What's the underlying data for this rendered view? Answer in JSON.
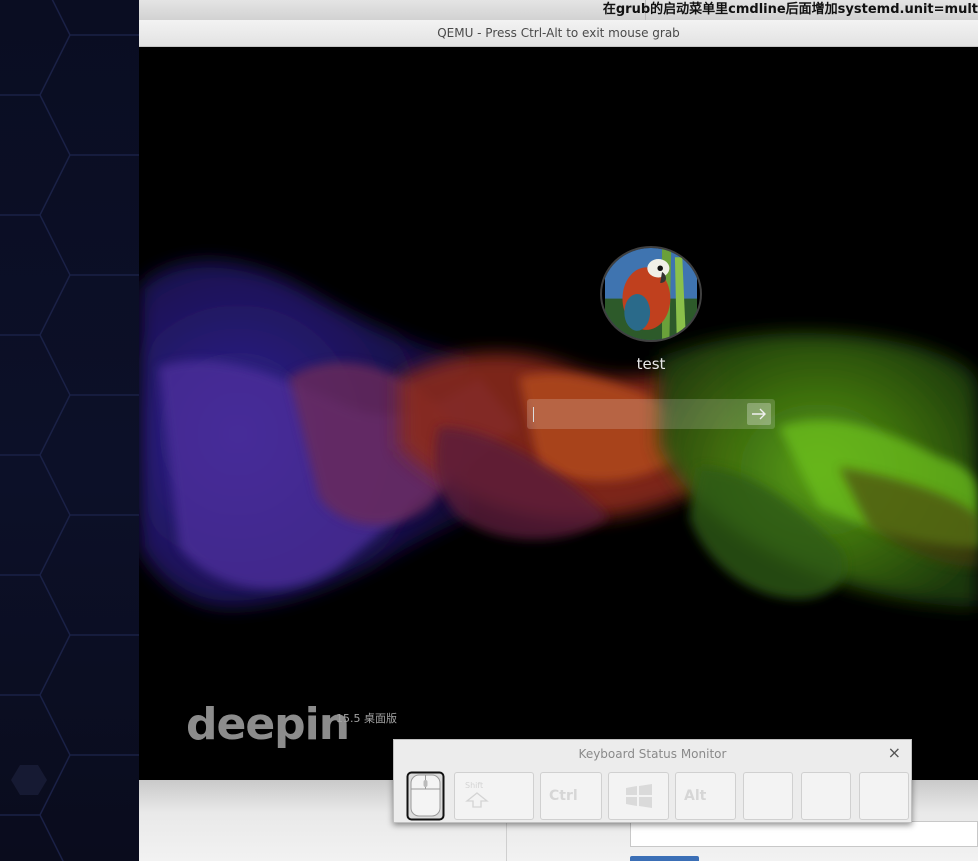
{
  "host": {
    "document_title": "在grub的启动菜单里cmdline后面增加systemd.unit=mult"
  },
  "qemu": {
    "title": "QEMU - Press Ctrl-Alt to exit mouse grab"
  },
  "login": {
    "username": "test",
    "password_value": "",
    "submit_icon": "arrow-right-icon"
  },
  "branding": {
    "logo_text": "deepin",
    "version_text": "15.5 桌面版"
  },
  "keyboard_monitor": {
    "title": "Keyboard Status Monitor",
    "close_label": "×",
    "keys": [
      {
        "label": "Shift",
        "icon": "shift-arrow-icon"
      },
      {
        "label": "Ctrl",
        "icon": ""
      },
      {
        "label": "",
        "icon": "windows-logo-icon"
      },
      {
        "label": "Alt",
        "icon": ""
      },
      {
        "label": "",
        "icon": ""
      },
      {
        "label": "",
        "icon": ""
      },
      {
        "label": "",
        "icon": ""
      }
    ]
  },
  "colors": {
    "guest_background": "#000000",
    "titlebar": "#e8e8e8",
    "logo": "#8c8c8c",
    "host_accent_button": "#3b6fb6"
  }
}
